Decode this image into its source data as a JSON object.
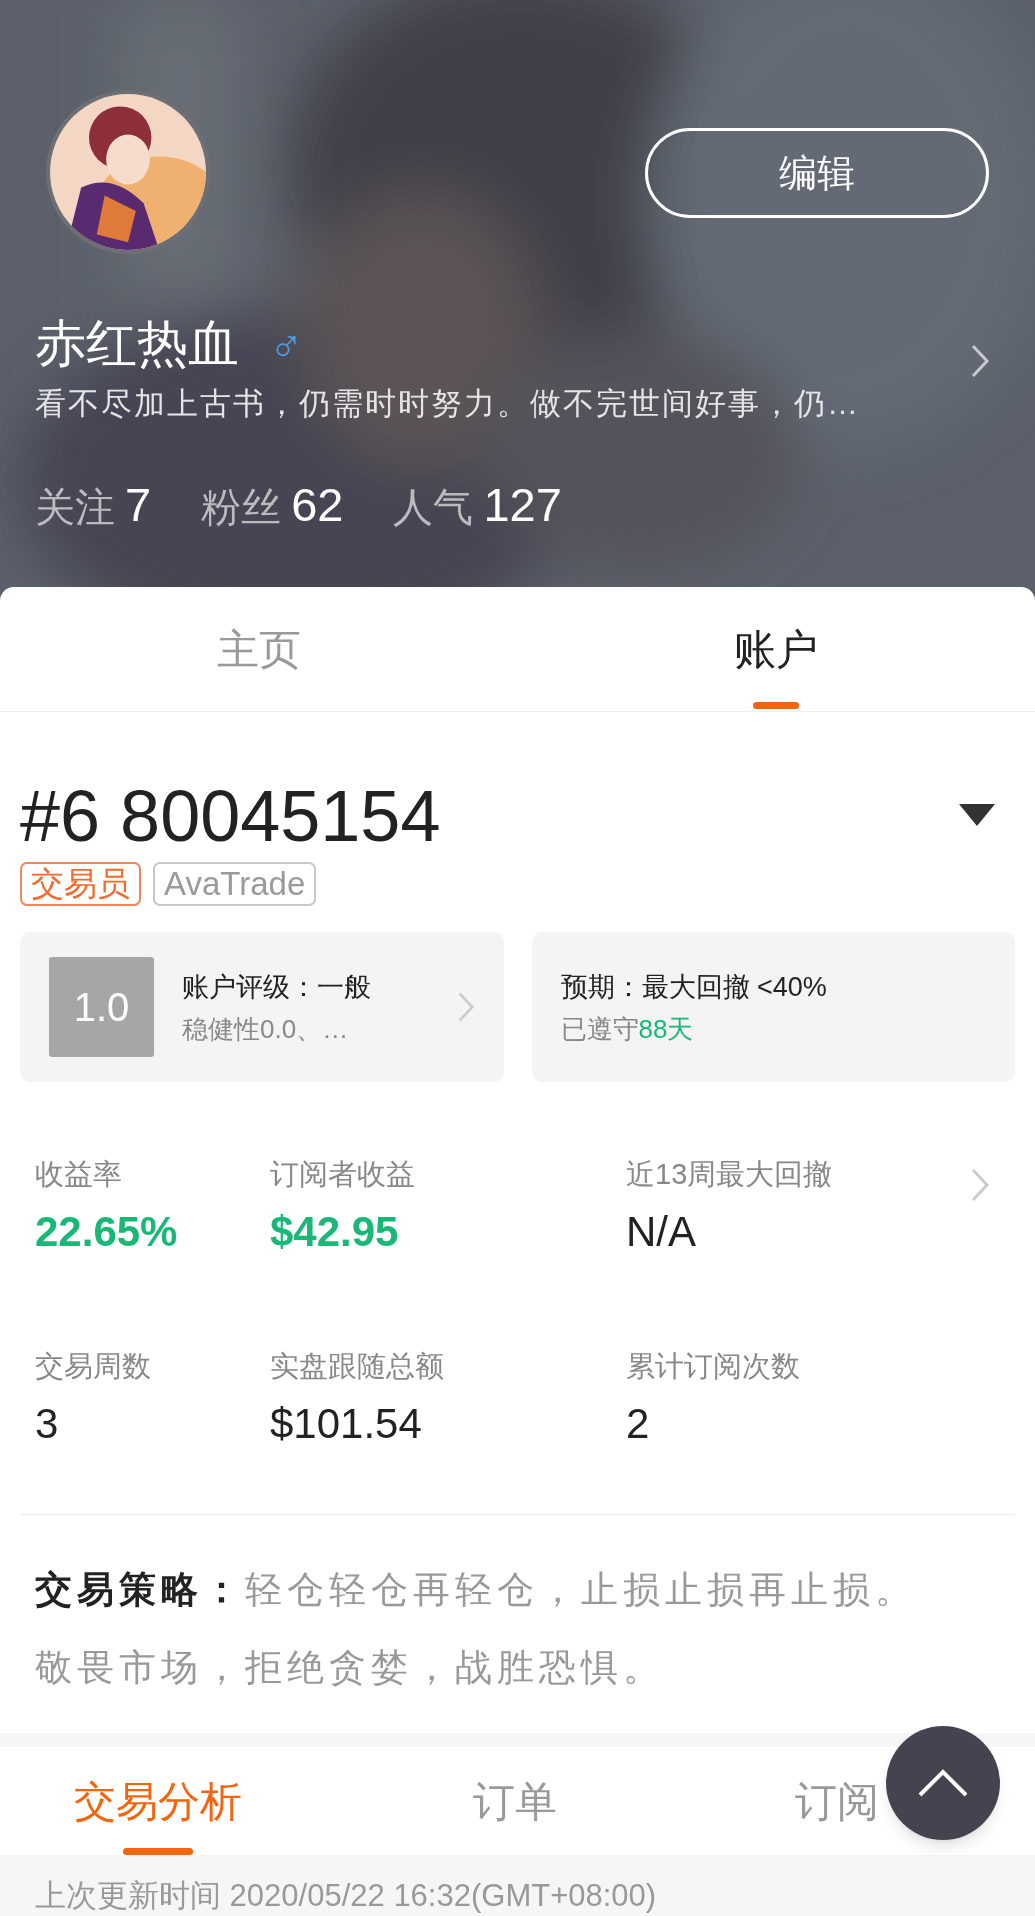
{
  "profile": {
    "edit_button": "编辑",
    "name": "赤红热血",
    "gender_symbol": "♂",
    "bio": "看不尽加上古书，仍需时时努力。做不完世间好事，仍…",
    "stats": [
      {
        "label": "关注",
        "value": "7"
      },
      {
        "label": "粉丝",
        "value": "62"
      },
      {
        "label": "人气",
        "value": "127"
      }
    ]
  },
  "tabs": [
    {
      "label": "主页",
      "selected": false
    },
    {
      "label": "账户",
      "selected": true
    }
  ],
  "account": {
    "number": "#6 80045154",
    "tags": [
      {
        "label": "交易员",
        "kind": "role"
      },
      {
        "label": "AvaTrade",
        "kind": "broker"
      }
    ]
  },
  "rating_card": {
    "score": "1.0",
    "title": "账户评级：一般",
    "subtitle": "稳健性0.0、…"
  },
  "expectation_card": {
    "title": "预期：最大回撤 <40%",
    "subtitle": "已遵守",
    "highlight": "88天"
  },
  "metrics": [
    {
      "label": "收益率",
      "value": "22.65%",
      "kind": "positive"
    },
    {
      "label": "订阅者收益",
      "value": "$42.95",
      "kind": "positive"
    },
    {
      "label": "近13周最大回撤",
      "value": "N/A",
      "kind": "neutral"
    },
    {
      "label": "交易周数",
      "value": "3",
      "kind": "neutral"
    },
    {
      "label": "实盘跟随总额",
      "value": "$101.54",
      "kind": "neutral"
    },
    {
      "label": "累计订阅次数",
      "value": "2",
      "kind": "neutral"
    }
  ],
  "strategy": {
    "label": "交易策略：",
    "lines": [
      "轻仓轻仓再轻仓，止损止损再止损。",
      "敬畏市场，拒绝贪婪，战胜恐惧。"
    ]
  },
  "bottom_tabs": [
    {
      "label": "交易分析",
      "selected": true
    },
    {
      "label": "订单",
      "selected": false
    },
    {
      "label": "订阅",
      "selected": false
    }
  ],
  "last_update": "上次更新时间 2020/05/22 16:32(GMT+08:00)"
}
